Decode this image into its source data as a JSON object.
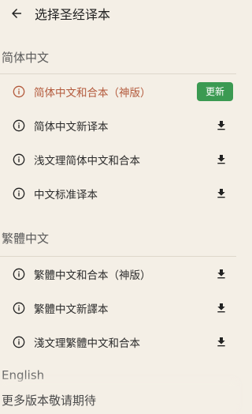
{
  "header": {
    "title": "选择圣经译本",
    "back_icon": "arrow-left-icon"
  },
  "sections": [
    {
      "title": "简体中文",
      "items": [
        {
          "label": "简体中文和合本（神版）",
          "action": "更新",
          "current": true
        },
        {
          "label": "简体中文新译本"
        },
        {
          "label": "浅文理简体中文和合本"
        },
        {
          "label": "中文标准译本"
        }
      ]
    },
    {
      "title": "繁體中文",
      "items": [
        {
          "label": "繁體中文和合本（神版）"
        },
        {
          "label": "繁體中文新譯本"
        },
        {
          "label": "淺文理繁體中文和合本"
        }
      ]
    },
    {
      "title": "English"
    }
  ],
  "footer": {
    "text": "更多版本敬请期待"
  },
  "colors": {
    "background": "#f4efe6",
    "current_item": "#b35a3c",
    "update_button": "#3b9a52"
  },
  "icons": {
    "info": "info-circle-icon",
    "download": "download-icon"
  }
}
